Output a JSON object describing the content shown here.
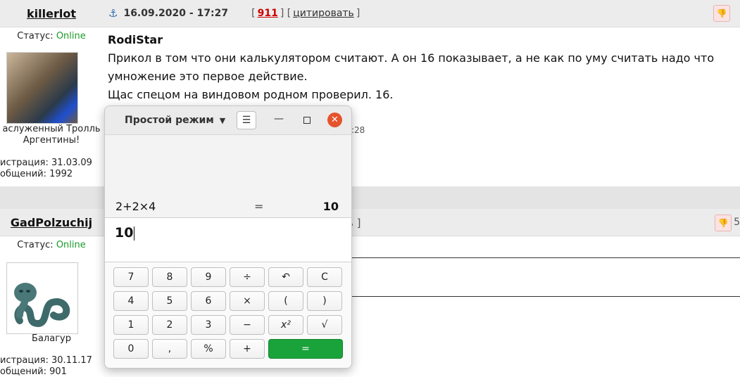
{
  "posts": [
    {
      "username": "killerlot",
      "status_label": "Статус:",
      "status": "Online",
      "rank": "аслуженный Тролль Аргентины!",
      "registration": "истрация: 31.03.09",
      "posts_count": "общений: 1992",
      "date": "16.09.2020 - 17:27",
      "post_number": "911",
      "quote_link": "цитировать",
      "body_author": "RodiStar",
      "body_lines": [
        "Прикол в том что они калькулятором считают. А он 16 показывает, а не как по уму считать надо что",
        "умножение это первое действие.",
        "Щас спецом на виндовом родном проверил. 16."
      ],
      "time_fragment": ":28"
    },
    {
      "username": "GadPolzuchij",
      "status_label": "Статус:",
      "status": "Online",
      "rank": "Балагур",
      "registration": "истрация: 30.11.17",
      "posts_count": "общений: 901",
      "link_fragment": "ь ]",
      "number_fragment": "5",
      "dashes": "-------------------"
    }
  ],
  "calculator": {
    "mode": "Простой режим",
    "history_expression": "2+2×4",
    "history_equals": "=",
    "history_result": "10",
    "entry": "10",
    "keys": [
      [
        "7",
        "8",
        "9",
        "÷",
        "↶",
        "C"
      ],
      [
        "4",
        "5",
        "6",
        "×",
        "(",
        ")"
      ],
      [
        "1",
        "2",
        "3",
        "−",
        "x²",
        "√"
      ],
      [
        "0",
        ",",
        "%",
        "+",
        "="
      ]
    ]
  },
  "colors": {
    "online": "#1a9c2a",
    "post_number": "#cc0000",
    "close_button": "#e5532c",
    "equals_button": "#1aa33a"
  }
}
